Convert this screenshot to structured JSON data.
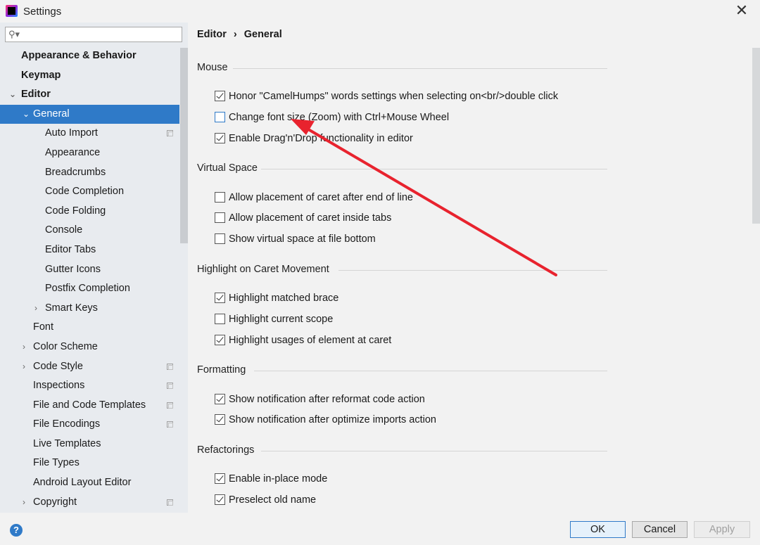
{
  "window": {
    "title": "Settings",
    "close_glyph": "✕"
  },
  "search": {
    "placeholder": "",
    "icon": "search-icon"
  },
  "sidebar": {
    "items": [
      {
        "label": "Appearance & Behavior"
      },
      {
        "label": "Keymap"
      },
      {
        "label": "Editor"
      },
      {
        "label": "General"
      },
      {
        "label": "Auto Import"
      },
      {
        "label": "Appearance"
      },
      {
        "label": "Breadcrumbs"
      },
      {
        "label": "Code Completion"
      },
      {
        "label": "Code Folding"
      },
      {
        "label": "Console"
      },
      {
        "label": "Editor Tabs"
      },
      {
        "label": "Gutter Icons"
      },
      {
        "label": "Postfix Completion"
      },
      {
        "label": "Smart Keys"
      },
      {
        "label": "Font"
      },
      {
        "label": "Color Scheme"
      },
      {
        "label": "Code Style"
      },
      {
        "label": "Inspections"
      },
      {
        "label": "File and Code Templates"
      },
      {
        "label": "File Encodings"
      },
      {
        "label": "Live Templates"
      },
      {
        "label": "File Types"
      },
      {
        "label": "Android Layout Editor"
      },
      {
        "label": "Copyright"
      }
    ]
  },
  "breadcrumb": {
    "parent": "Editor",
    "separator": "›",
    "current": "General"
  },
  "sections": {
    "mouse": {
      "title": "Mouse",
      "options": [
        {
          "label": "Honor \"CamelHumps\" words settings when selecting on<br/>double click",
          "checked": true
        },
        {
          "label": "Change font size (Zoom) with Ctrl+Mouse Wheel",
          "checked": false
        },
        {
          "label": "Enable Drag'n'Drop functionality in editor",
          "checked": true
        }
      ]
    },
    "virtual_space": {
      "title": "Virtual Space",
      "options": [
        {
          "label": "Allow placement of caret after end of line",
          "checked": false
        },
        {
          "label": "Allow placement of caret inside tabs",
          "checked": false
        },
        {
          "label": "Show virtual space at file bottom",
          "checked": false
        }
      ]
    },
    "caret_movement": {
      "title": "Highlight on Caret Movement",
      "options": [
        {
          "label": "Highlight matched brace",
          "checked": true
        },
        {
          "label": "Highlight current scope",
          "checked": false
        },
        {
          "label": "Highlight usages of element at caret",
          "checked": true
        }
      ]
    },
    "formatting": {
      "title": "Formatting",
      "options": [
        {
          "label": "Show notification after reformat code action",
          "checked": true
        },
        {
          "label": "Show notification after optimize imports action",
          "checked": true
        }
      ]
    },
    "refactorings": {
      "title": "Refactorings",
      "options": [
        {
          "label": "Enable in-place mode",
          "checked": true
        },
        {
          "label": "Preselect old name",
          "checked": true
        }
      ]
    }
  },
  "buttons": {
    "ok": "OK",
    "cancel": "Cancel",
    "apply": "Apply",
    "help": "?"
  },
  "colors": {
    "selection": "#2f7ac8",
    "annotation_arrow": "#e8232e"
  }
}
